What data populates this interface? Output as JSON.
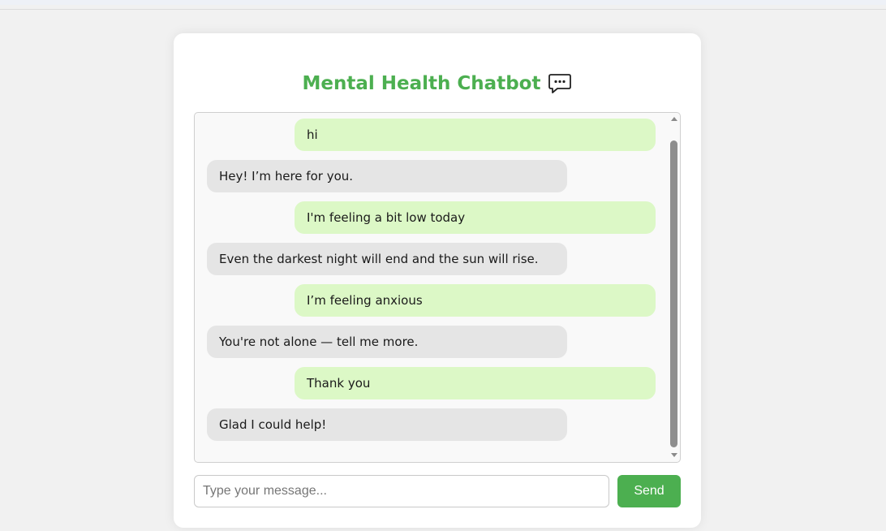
{
  "header": {
    "title": "Mental Health Chatbot",
    "icon": "speech-bubble-dots-icon",
    "accent_color": "#4caf50"
  },
  "messages": [
    {
      "sender": "user",
      "text": "hi"
    },
    {
      "sender": "bot",
      "text": "Hey! I’m here for you."
    },
    {
      "sender": "user",
      "text": "I'm feeling a bit low today"
    },
    {
      "sender": "bot",
      "text": "Even the darkest night will end and the sun will rise."
    },
    {
      "sender": "user",
      "text": "I’m feeling anxious"
    },
    {
      "sender": "bot",
      "text": "You're not alone — tell me more."
    },
    {
      "sender": "user",
      "text": "Thank you"
    },
    {
      "sender": "bot",
      "text": "Glad I could help!"
    }
  ],
  "colors": {
    "user_bubble": "#dcf8c6",
    "bot_bubble": "#e5e5e5",
    "send_button": "#4caf50"
  },
  "composer": {
    "placeholder": "Type your message...",
    "value": "",
    "send_label": "Send"
  }
}
